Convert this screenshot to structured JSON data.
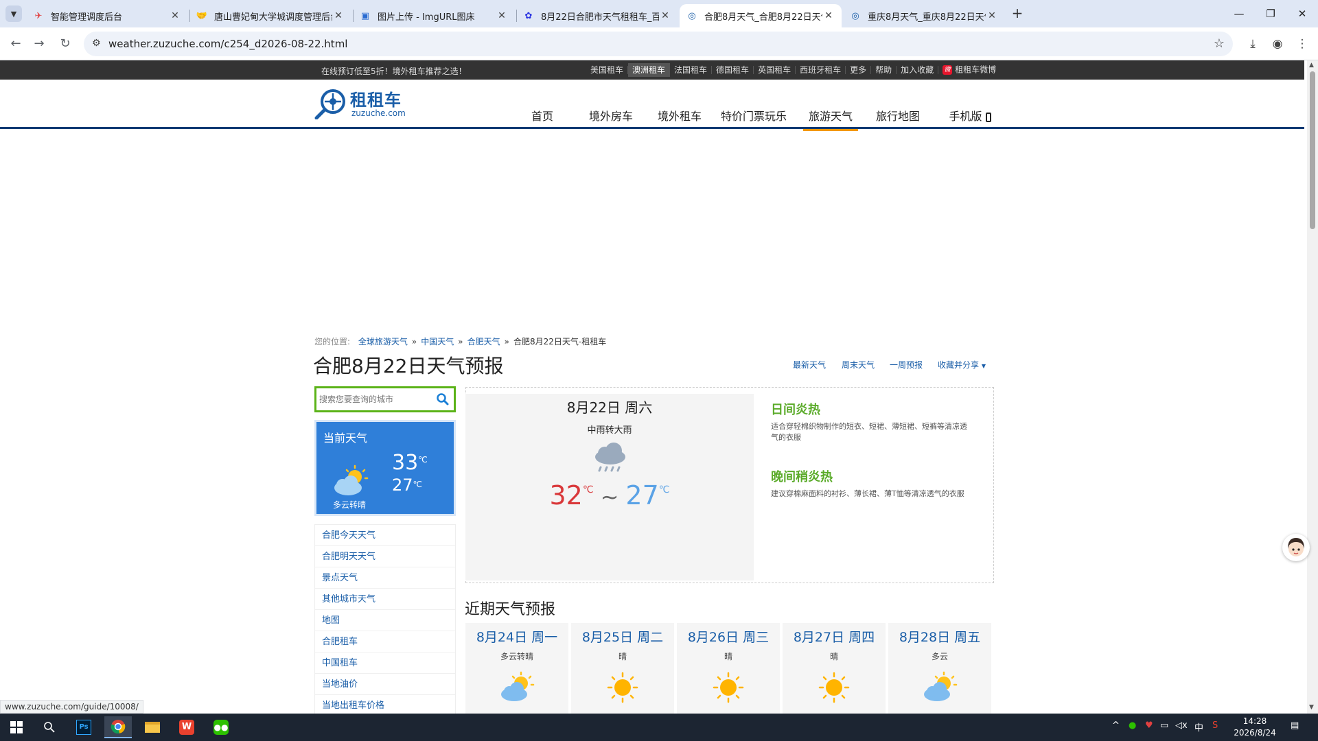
{
  "browser": {
    "tabs": [
      {
        "title": "智能管理调度后台",
        "active": false
      },
      {
        "title": "唐山曹妃甸大学城调度管理后台",
        "active": false
      },
      {
        "title": "图片上传 - ImgURL图床",
        "active": false
      },
      {
        "title": "8月22日合肥市天气租租车_百度",
        "active": false
      },
      {
        "title": "合肥8月天气_合肥8月22日天气",
        "active": true
      },
      {
        "title": "重庆8月天气_重庆8月22日天气",
        "active": false
      }
    ],
    "new_tab": "+",
    "url": "weather.zuzuche.com/c254_d2026-08-22.html",
    "status_url": "www.zuzuche.com/guide/10008/"
  },
  "topbar": {
    "promo": "在线预订低至5折！境外租车推荐之选！",
    "links": [
      "美国租车",
      "澳洲租车",
      "法国租车",
      "德国租车",
      "英国租车",
      "西班牙租车",
      "更多",
      "帮助",
      "加入收藏"
    ],
    "highlight_index": 1,
    "weibo": "租租车微博"
  },
  "header": {
    "logo_cn": "租租车",
    "logo_en": "zuzuche.com",
    "nav": [
      "首页",
      "境外房车",
      "境外租车",
      "特价门票玩乐",
      "旅游天气",
      "旅行地图",
      "手机版"
    ],
    "active_index": 4
  },
  "breadcrumb": {
    "prefix": "您的位置:",
    "links": [
      "全球旅游天气",
      "中国天气",
      "合肥天气"
    ],
    "current": "合肥8月22日天气-租租车",
    "sep": "»"
  },
  "page_title": "合肥8月22日天气预报",
  "top_links": [
    "最新天气",
    "周末天气",
    "一周预报",
    "收藏并分享"
  ],
  "search": {
    "placeholder": "搜索您要查询的城市"
  },
  "current_weather": {
    "label": "当前天气",
    "high": "33",
    "low": "27",
    "unit": "℃",
    "condition": "多云转晴"
  },
  "sidebar_links": [
    "合肥今天天气",
    "合肥明天天气",
    "景点天气",
    "其他城市天气",
    "地图",
    "合肥租车",
    "中国租车",
    "当地油价",
    "当地出租车价格"
  ],
  "day": {
    "date": "8月22日 周六",
    "condition": "中雨转大雨",
    "high": "32",
    "low": "27",
    "unit": "℃",
    "tilde": "~"
  },
  "tips": [
    {
      "title": "日间炎热",
      "text": "适合穿轻棉织物制作的短衣、短裙、薄短裙、短裤等清凉透气的衣服"
    },
    {
      "title": "晚间稍炎热",
      "text": "建议穿棉麻面料的衬衫、薄长裙、薄T恤等清凉透气的衣服"
    }
  ],
  "recent": {
    "title": "近期天气预报",
    "days": [
      {
        "date": "8月24日 周一",
        "condition": "多云转晴",
        "icon": "partly-cloudy"
      },
      {
        "date": "8月25日 周二",
        "condition": "晴",
        "icon": "sunny"
      },
      {
        "date": "8月26日 周三",
        "condition": "晴",
        "icon": "sunny"
      },
      {
        "date": "8月27日 周四",
        "condition": "晴",
        "icon": "sunny"
      },
      {
        "date": "8月28日 周五",
        "condition": "多云",
        "icon": "partly-cloudy"
      }
    ]
  },
  "taskbar": {
    "time": "14:28",
    "date": "2026/8/24",
    "ime": "中"
  },
  "colors": {
    "brand_blue": "#1a5ea8",
    "nav_active": "#f39800",
    "search_green": "#5bb318",
    "hot_red": "#d9383a",
    "cool_blue": "#5aa2e6",
    "current_bg": "#2f7fd9"
  }
}
